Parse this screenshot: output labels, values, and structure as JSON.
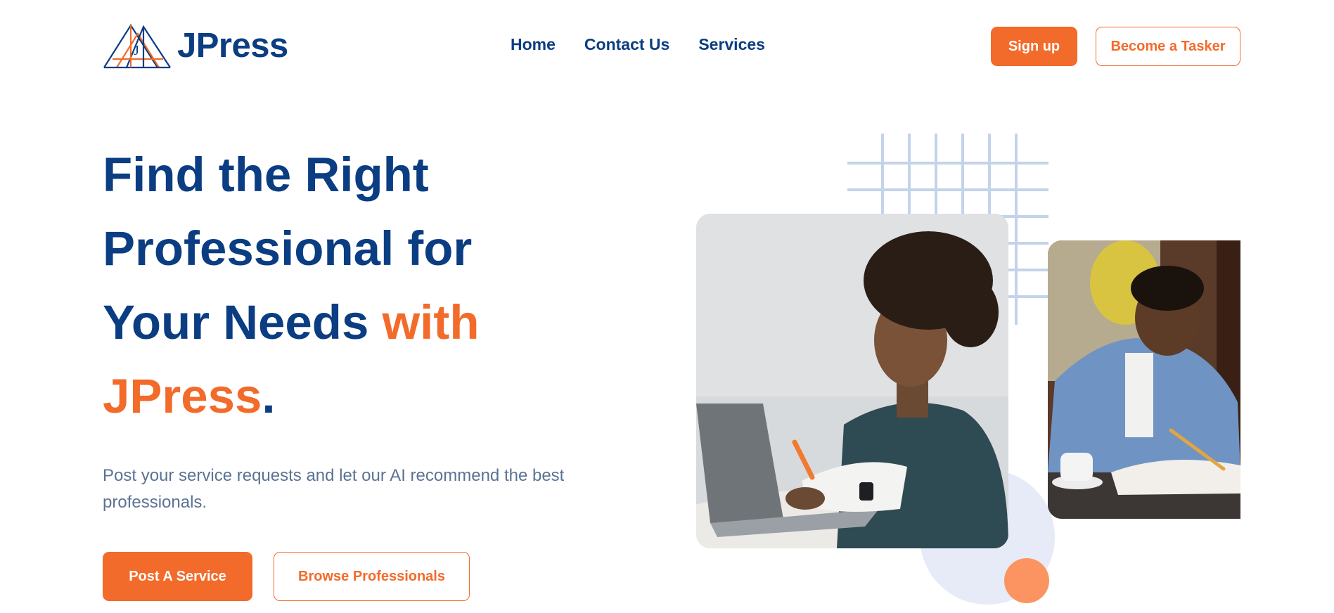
{
  "brand": {
    "name": "JPress",
    "logo_icon": "bridge-triangle-logo",
    "logo_letter": "J",
    "colors": {
      "primary": "#0b3d82",
      "accent": "#f26b2a",
      "muted": "#5b7393"
    }
  },
  "nav": {
    "items": [
      {
        "label": "Home"
      },
      {
        "label": "Contact Us"
      },
      {
        "label": "Services"
      }
    ]
  },
  "header": {
    "signup_label": "Sign up",
    "tasker_label": "Become a Tasker"
  },
  "hero": {
    "title_main": "Find the Right Professional for Your Needs ",
    "title_accent": "with JPress",
    "title_end": ".",
    "subtitle": "Post your service requests and let our AI recommend the best professionals.",
    "post_label": "Post A Service",
    "browse_label": "Browse Professionals"
  },
  "images": {
    "main": "student-writing-at-laptop-photo",
    "side": "student-writing-in-notebook-photo"
  }
}
